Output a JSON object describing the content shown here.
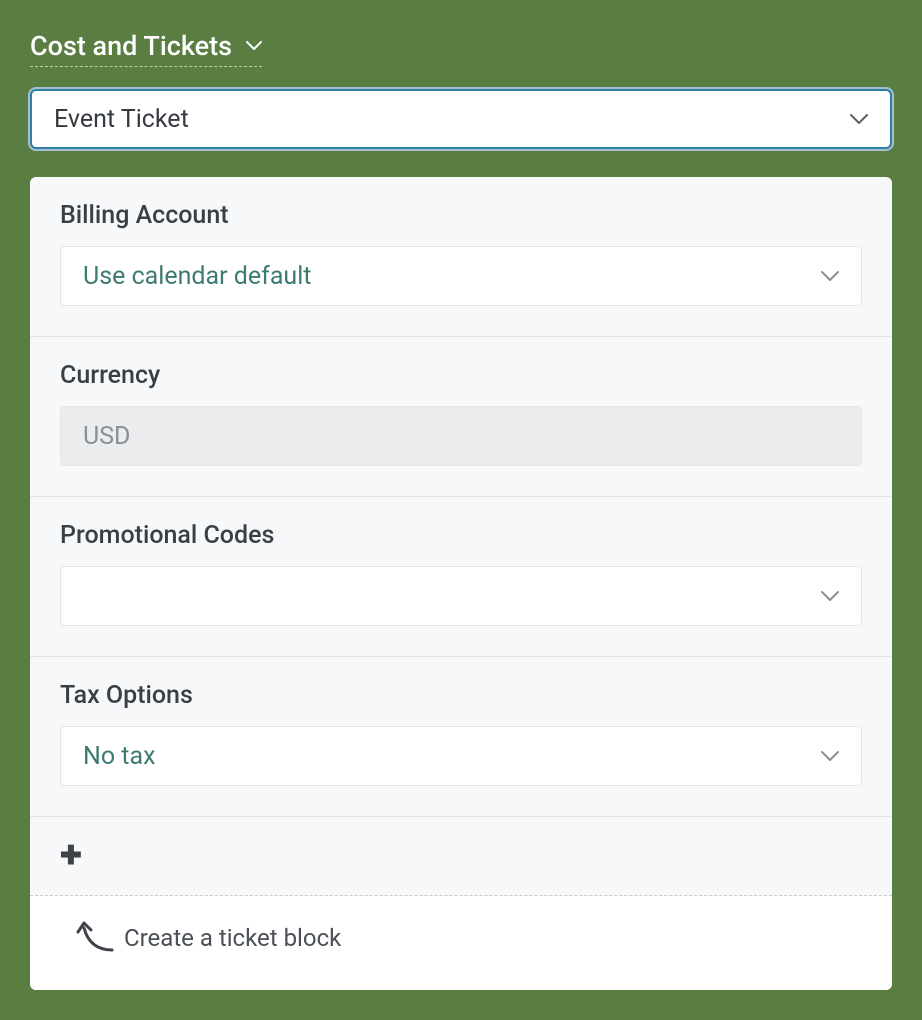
{
  "section": {
    "title": "Cost and Tickets"
  },
  "ticket_type": {
    "value": "Event Ticket"
  },
  "fields": {
    "billing": {
      "label": "Billing Account",
      "value": "Use calendar default"
    },
    "currency": {
      "label": "Currency",
      "value": "USD"
    },
    "promo": {
      "label": "Promotional Codes",
      "value": ""
    },
    "tax": {
      "label": "Tax Options",
      "value": "No tax"
    }
  },
  "hint": {
    "text": "Create a ticket block"
  }
}
